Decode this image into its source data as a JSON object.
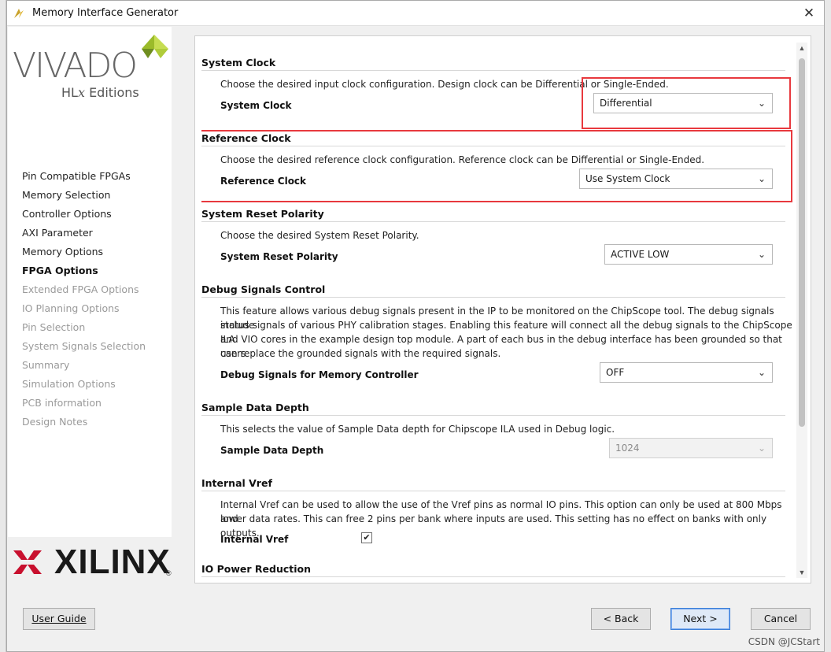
{
  "window": {
    "title": "Memory Interface Generator",
    "close_glyph": "✕"
  },
  "branding": {
    "vivado": "VIVADO",
    "hlx_prefix": "HL",
    "hlx_x": "x",
    "hlx_suffix": " Editions",
    "xilinx": "XILINX",
    "registered": "®"
  },
  "nav": {
    "items": [
      {
        "label": "Pin Compatible FPGAs",
        "state": "normal"
      },
      {
        "label": "Memory Selection",
        "state": "normal"
      },
      {
        "label": "Controller Options",
        "state": "normal"
      },
      {
        "label": "AXI Parameter",
        "state": "normal"
      },
      {
        "label": "Memory Options",
        "state": "normal"
      },
      {
        "label": "FPGA Options",
        "state": "current"
      },
      {
        "label": "Extended FPGA Options",
        "state": "disabled"
      },
      {
        "label": "IO Planning Options",
        "state": "disabled"
      },
      {
        "label": "Pin Selection",
        "state": "disabled"
      },
      {
        "label": "System Signals Selection",
        "state": "disabled"
      },
      {
        "label": "Summary",
        "state": "disabled"
      },
      {
        "label": "Simulation Options",
        "state": "disabled"
      },
      {
        "label": "PCB information",
        "state": "disabled"
      },
      {
        "label": "Design Notes",
        "state": "disabled"
      }
    ]
  },
  "sections": {
    "system_clock": {
      "title": "System Clock",
      "description": "Choose the desired input clock configuration. Design clock can be Differential or Single-Ended.",
      "field_label": "System Clock",
      "value": "Differential"
    },
    "reference_clock": {
      "title": "Reference Clock",
      "description": "Choose the desired reference clock configuration. Reference clock can be Differential or Single-Ended.",
      "field_label": "Reference Clock",
      "value": "Use System Clock"
    },
    "reset_polarity": {
      "title": "System Reset Polarity",
      "description": "Choose the desired System Reset Polarity.",
      "field_label": "System Reset Polarity",
      "value": "ACTIVE LOW"
    },
    "debug_signals": {
      "title": "Debug Signals Control",
      "description_lines": [
        "This feature allows various debug signals present in the IP to be monitored on the ChipScope tool. The debug signals include",
        "status signals of various PHY calibration stages. Enabling this feature will connect all the debug signals to the ChipScope ILA",
        "and VIO cores in the example design top module. A part of each bus in the debug interface has been grounded so that users",
        "can replace the grounded signals with the required signals."
      ],
      "field_label": "Debug Signals for Memory Controller",
      "value": "OFF"
    },
    "sample_depth": {
      "title": "Sample Data Depth",
      "description": "This selects the value of Sample Data depth for Chipscope ILA used in Debug logic.",
      "field_label": "Sample Data Depth",
      "value": "1024"
    },
    "internal_vref": {
      "title": "Internal Vref",
      "description_lines": [
        "Internal Vref can be used to allow the use of the Vref pins as normal IO pins. This option can only be used at 800 Mbps and",
        "lower data rates. This can free 2 pins per bank where inputs are used. This setting has no effect on banks with only outputs."
      ],
      "field_label": "Internal Vref",
      "checked": true,
      "check_glyph": "✔"
    },
    "io_power": {
      "title": "IO Power Reduction"
    }
  },
  "chevron": "⌄",
  "scroll": {
    "up": "▲",
    "down": "▼"
  },
  "buttons": {
    "user_guide": "User Guide",
    "back": "< Back",
    "next": "Next >",
    "cancel": "Cancel"
  },
  "watermark": "CSDN @JCStart",
  "colors": {
    "highlight": "#e8393e",
    "primary_border": "#3c7fd8",
    "xilinx_red": "#c8102e",
    "vivado_leaf": "#9bbb2a"
  }
}
